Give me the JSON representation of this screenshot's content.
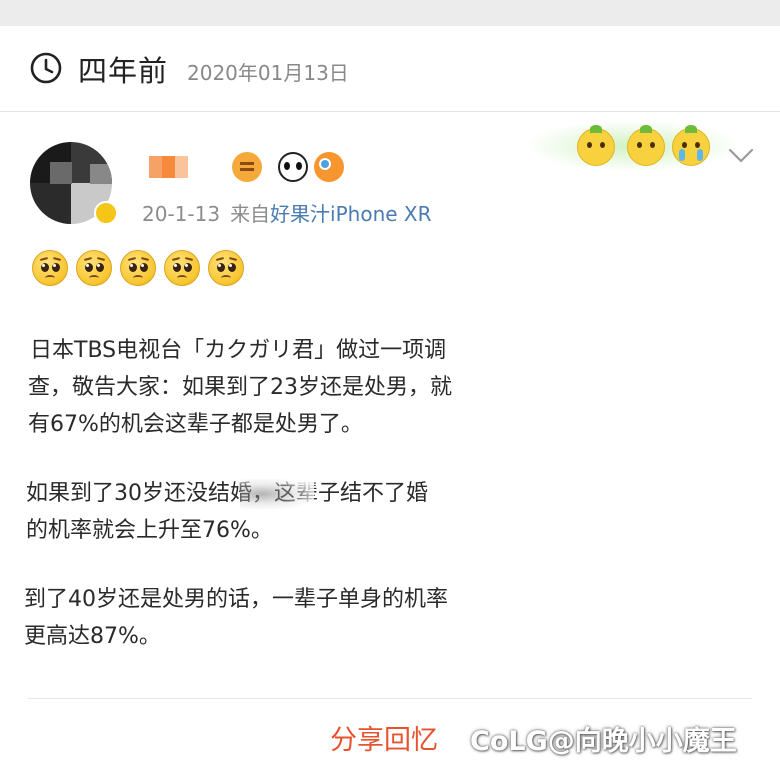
{
  "memory": {
    "time_ago": "四年前",
    "date": "2020年01月13日"
  },
  "post": {
    "date": "20-1-13",
    "source_prefix": "来自",
    "source": "好果汁iPhone XR",
    "emoji_count": 5,
    "paragraphs": [
      {
        "lines": [
          "日本TBS电视台「カクガリ君」做过一项调",
          "查，敬告大家：如果到了23岁还是处男，就",
          "有67%的机会这辈子都是处男了。"
        ]
      },
      {
        "lines": [
          "如果到了30岁还没结婚，这辈子结不了婚",
          "的机率就会上升至76%。"
        ]
      },
      {
        "lines": [
          "到了40岁还是处男的话，一辈子单身的机率",
          "更高达87%。"
        ]
      }
    ]
  },
  "footer": {
    "share_label": "分享回忆",
    "watermark": "CoLG@向晚小小魔王"
  },
  "colors": {
    "link_blue": "#4a7cb1",
    "share_red": "#e8532f"
  },
  "icons": [
    "clock-icon",
    "chevron-down-icon",
    "verified-badge-icon"
  ]
}
